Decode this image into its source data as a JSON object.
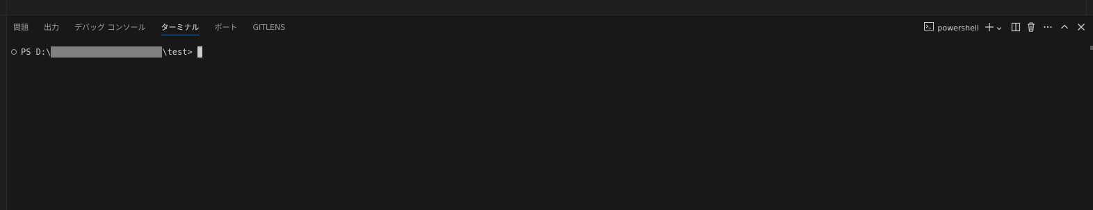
{
  "panel": {
    "tabs": [
      {
        "label": "問題",
        "active": false
      },
      {
        "label": "出力",
        "active": false
      },
      {
        "label": "デバッグ コンソール",
        "active": false
      },
      {
        "label": "ターミナル",
        "active": true
      },
      {
        "label": "ポート",
        "active": false
      },
      {
        "label": "GITLENS",
        "active": false
      }
    ],
    "actions": {
      "shell_name": "powershell",
      "icons": [
        "terminal-icon",
        "plus-icon",
        "chevron-down-icon",
        "split-icon",
        "trash-icon",
        "more-icon",
        "chevron-up-icon",
        "close-icon"
      ]
    }
  },
  "terminal": {
    "prompt_prefix": "PS D:\\",
    "prompt_suffix": "\\test>",
    "redacted": true
  },
  "colors": {
    "panel_bg": "#181818",
    "accent": "#0078d4",
    "text": "#cccccc",
    "inactive_text": "#9d9d9d"
  }
}
